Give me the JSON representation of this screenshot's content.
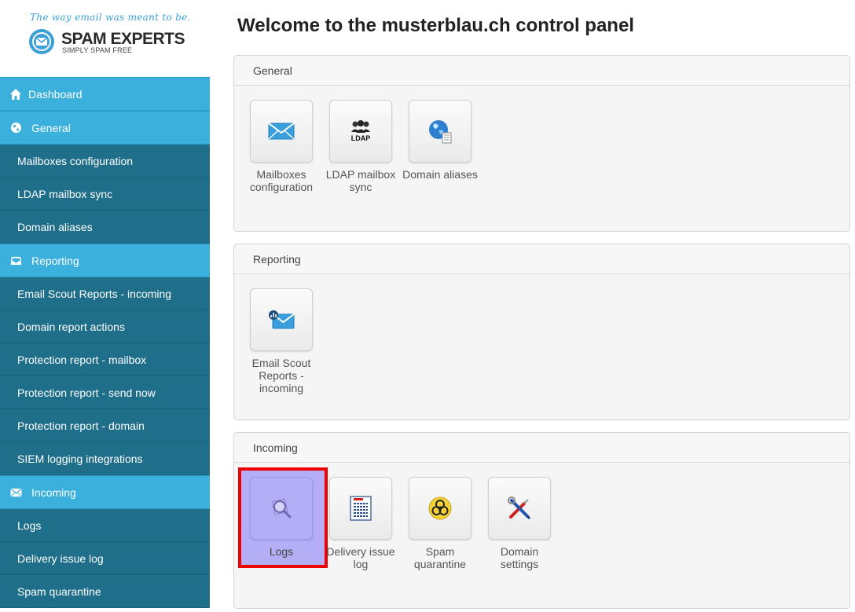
{
  "brand": {
    "tagline": "The way email was meant to be.",
    "name": "SPAM EXPERTS",
    "slogan": "SIMPLY SPAM FREE"
  },
  "sidebar": {
    "dashboard": "Dashboard",
    "sections": [
      {
        "label": "General",
        "icon": "globe-icon",
        "items": [
          "Mailboxes configuration",
          "LDAP mailbox sync",
          "Domain aliases"
        ]
      },
      {
        "label": "Reporting",
        "icon": "inbox-icon",
        "items": [
          "Email Scout Reports - incoming",
          "Domain report actions",
          "Protection report - mailbox",
          "Protection report - send now",
          "Protection report - domain",
          "SIEM logging integrations"
        ]
      },
      {
        "label": "Incoming",
        "icon": "envelope-icon",
        "items": [
          "Logs",
          "Delivery issue log",
          "Spam quarantine"
        ]
      }
    ]
  },
  "main": {
    "title": "Welcome to the musterblau.ch control panel",
    "panels": [
      {
        "heading": "General",
        "tiles": [
          {
            "line1": "Mailboxes",
            "line2": "configuration",
            "icon": "mail-icon"
          },
          {
            "line1": "LDAP mailbox",
            "line2": "sync",
            "icon": "ldap-icon"
          },
          {
            "line1": "Domain aliases",
            "line2": "",
            "icon": "globe-doc-icon"
          }
        ]
      },
      {
        "heading": "Reporting",
        "tiles": [
          {
            "line1": "Email Scout",
            "line2": "Reports -",
            "line3": "incoming",
            "icon": "mail-report-icon"
          }
        ]
      },
      {
        "heading": "Incoming",
        "tiles": [
          {
            "line1": "Logs",
            "line2": "",
            "icon": "magnifier-icon",
            "selected": true
          },
          {
            "line1": "Delivery issue",
            "line2": "log",
            "icon": "document-list-icon"
          },
          {
            "line1": "Spam",
            "line2": "quarantine",
            "icon": "biohazard-icon"
          },
          {
            "line1": "Domain",
            "line2": "settings",
            "icon": "tools-icon"
          }
        ]
      }
    ]
  },
  "colors": {
    "section_bg": "#3bb0dd",
    "item_bg": "#1f6f8b",
    "selected_tile": "#b3aef5",
    "highlight_border": "#ee0000"
  }
}
